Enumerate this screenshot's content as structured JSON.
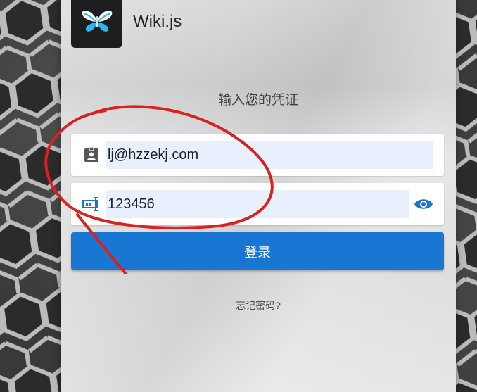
{
  "brand": {
    "name": "Wiki.js",
    "logo_icon": "butterfly-logo-icon"
  },
  "login": {
    "subtitle": "输入您的凭证",
    "email_value": "lj@hzzekj.com",
    "email_icon": "account-box-icon",
    "password_value": "123456",
    "password_icon": "password-icon",
    "show_password_icon": "eye-icon",
    "submit_label": "登录",
    "forgot_label": "忘记密码?"
  },
  "colors": {
    "accent": "#1976d2",
    "autofill_bg": "#e8f0fe",
    "annotation": "#d9211e"
  }
}
